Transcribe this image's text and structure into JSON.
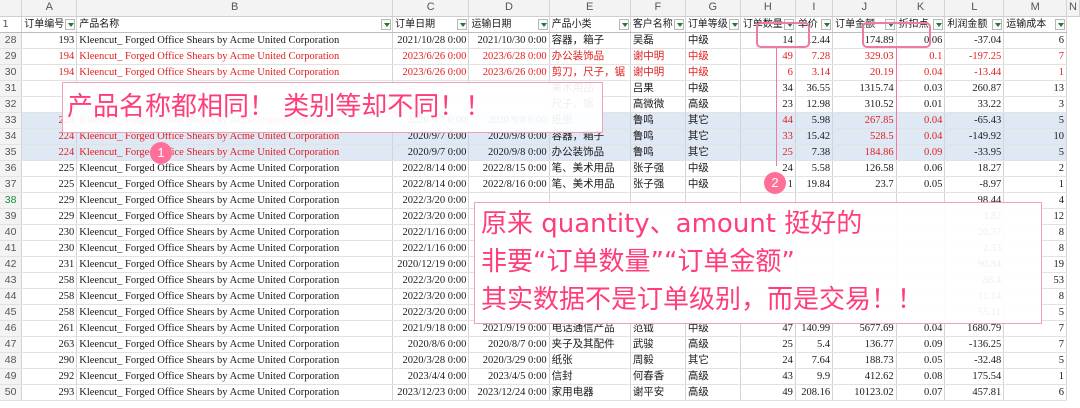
{
  "columns": [
    "A",
    "B",
    "C",
    "D",
    "E",
    "F",
    "G",
    "H",
    "I",
    "J",
    "K",
    "L",
    "M",
    "N"
  ],
  "header_row_number": "1",
  "fields": [
    "订单编号",
    "产品名称",
    "订单日期",
    "运输日期",
    "产品小类",
    "客户名称",
    "订单等级",
    "订单数量",
    "单价",
    "订单金额",
    "折扣点",
    "利润金额",
    "运输成本"
  ],
  "rows": [
    {
      "num": "28",
      "cells": [
        "193",
        "Kleencut_ Forged Office Shears by Acme United Corporation",
        "2021/10/28 0:00",
        "2021/10/30 0:00",
        "容器，箱子",
        "吴磊",
        "中级",
        "14",
        "12.44",
        "174.89",
        "0.06",
        "-37.04",
        "6"
      ],
      "style": ""
    },
    {
      "num": "29",
      "cells": [
        "194",
        "Kleencut_ Forged Office Shears by Acme United Corporation",
        "2023/6/26 0:00",
        "2023/6/28 0:00",
        "办公装饰品",
        "谢中明",
        "中级",
        "49",
        "7.28",
        "329.03",
        "0.1",
        "-197.25",
        "7"
      ],
      "style": "red"
    },
    {
      "num": "30",
      "cells": [
        "194",
        "Kleencut_ Forged Office Shears by Acme United Corporation",
        "2023/6/26 0:00",
        "2023/6/26 0:00",
        "剪刀，尺子，锯",
        "谢中明",
        "中级",
        "6",
        "3.14",
        "20.19",
        "0.04",
        "-13.44",
        "1"
      ],
      "style": "red"
    },
    {
      "num": "31",
      "cells": [
        "",
        "",
        "",
        "",
        "美术用品",
        "吕果",
        "中级",
        "34",
        "36.55",
        "1315.74",
        "0.03",
        "260.87",
        "13"
      ],
      "style": ""
    },
    {
      "num": "32",
      "cells": [
        "",
        "",
        "",
        "",
        "尺子，锯",
        "高微微",
        "高级",
        "23",
        "12.98",
        "310.52",
        "0.01",
        "33.22",
        "3"
      ],
      "style": ""
    },
    {
      "num": "33",
      "cells": [
        "224",
        "Kleencut_ Forged Office Shears by Acme United Corporation",
        "2020/9/7 0:00",
        "2020/9/8 0:00",
        "纸张",
        "鲁鸣",
        "其它",
        "44",
        "5.98",
        "267.85",
        "0.04",
        "-65.43",
        "5"
      ],
      "style": "blue"
    },
    {
      "num": "34",
      "cells": [
        "224",
        "Kleencut_ Forged Office Shears by Acme United Corporation",
        "2020/9/7 0:00",
        "2020/9/8 0:00",
        "容器，箱子",
        "鲁鸣",
        "其它",
        "33",
        "15.42",
        "528.5",
        "0.04",
        "-149.92",
        "10"
      ],
      "style": "blue"
    },
    {
      "num": "35",
      "cells": [
        "224",
        "Kleencut_ Forged Office Shears by Acme United Corporation",
        "2020/9/7 0:00",
        "2020/9/8 0:00",
        "办公装饰品",
        "鲁鸣",
        "其它",
        "25",
        "7.38",
        "184.86",
        "0.09",
        "-33.95",
        "5"
      ],
      "style": "blue"
    },
    {
      "num": "36",
      "cells": [
        "225",
        "Kleencut_ Forged Office Shears by Acme United Corporation",
        "2022/8/14 0:00",
        "2022/8/15 0:00",
        "笔、美术用品",
        "张子强",
        "中级",
        "24",
        "5.58",
        "126.58",
        "0.06",
        "18.27",
        "2"
      ],
      "style": ""
    },
    {
      "num": "37",
      "cells": [
        "225",
        "Kleencut_ Forged Office Shears by Acme United Corporation",
        "2022/8/14 0:00",
        "2022/8/16 0:00",
        "笔、美术用品",
        "张子强",
        "中级",
        "1",
        "19.84",
        "23.7",
        "0.05",
        "-8.97",
        "1"
      ],
      "style": ""
    },
    {
      "num": "38",
      "cells": [
        "229",
        "Kleencut_ Forged Office Shears by Acme United Corporation",
        "2022/3/20 0:00",
        "",
        "",
        "",
        "",
        "",
        "",
        "",
        "",
        "98.44",
        "4"
      ],
      "style": "sel"
    },
    {
      "num": "39",
      "cells": [
        "229",
        "Kleencut_ Forged Office Shears by Acme United Corporation",
        "2022/3/20 0:00",
        "",
        "",
        "",
        "",
        "",
        "",
        "",
        "",
        "3.82",
        "12"
      ],
      "style": ""
    },
    {
      "num": "40",
      "cells": [
        "230",
        "Kleencut_ Forged Office Shears by Acme United Corporation",
        "2022/1/16 0:00",
        "",
        "",
        "",
        "",
        "",
        "",
        "",
        "",
        "20.37",
        "8"
      ],
      "style": ""
    },
    {
      "num": "41",
      "cells": [
        "230",
        "Kleencut_ Forged Office Shears by Acme United Corporation",
        "2022/1/16 0:00",
        "",
        "",
        "",
        "",
        "",
        "",
        "",
        "",
        "2.33",
        "8"
      ],
      "style": ""
    },
    {
      "num": "42",
      "cells": [
        "231",
        "Kleencut_ Forged Office Shears by Acme United Corporation",
        "2020/12/19 0:00",
        "",
        "",
        "",
        "",
        "",
        "",
        "",
        "",
        "90.84",
        "19"
      ],
      "style": ""
    },
    {
      "num": "43",
      "cells": [
        "258",
        "Kleencut_ Forged Office Shears by Acme United Corporation",
        "2022/3/20 0:00",
        "",
        "",
        "",
        "",
        "",
        "",
        "",
        "",
        "88.4",
        "53"
      ],
      "style": ""
    },
    {
      "num": "44",
      "cells": [
        "258",
        "Kleencut_ Forged Office Shears by Acme United Corporation",
        "2022/3/20 0:00",
        "",
        "",
        "",
        "",
        "",
        "",
        "",
        "",
        "11.14",
        "8"
      ],
      "style": ""
    },
    {
      "num": "45",
      "cells": [
        "258",
        "Kleencut_ Forged Office Shears by Acme United Corporation",
        "2022/3/20 0:00",
        "",
        "",
        "",
        "",
        "",
        "",
        "",
        "",
        "55.11",
        "5"
      ],
      "style": ""
    },
    {
      "num": "46",
      "cells": [
        "261",
        "Kleencut_ Forged Office Shears by Acme United Corporation",
        "2021/9/18 0:00",
        "2021/9/19 0:00",
        "电话通信产品",
        "范钺",
        "中级",
        "47",
        "140.99",
        "5677.69",
        "0.04",
        "1680.79",
        "7"
      ],
      "style": ""
    },
    {
      "num": "47",
      "cells": [
        "263",
        "Kleencut_ Forged Office Shears by Acme United Corporation",
        "2020/8/6 0:00",
        "2020/8/7 0:00",
        "夹子及其配件",
        "武骏",
        "高级",
        "25",
        "5.4",
        "136.77",
        "0.09",
        "-136.25",
        "7"
      ],
      "style": ""
    },
    {
      "num": "48",
      "cells": [
        "290",
        "Kleencut_ Forged Office Shears by Acme United Corporation",
        "2020/3/28 0:00",
        "2020/3/29 0:00",
        "纸张",
        "周毅",
        "其它",
        "24",
        "7.64",
        "188.73",
        "0.05",
        "-32.48",
        "5"
      ],
      "style": ""
    },
    {
      "num": "49",
      "cells": [
        "292",
        "Kleencut_ Forged Office Shears by Acme United Corporation",
        "2023/4/4 0:00",
        "2023/4/5 0:00",
        "信封",
        "何春香",
        "高级",
        "43",
        "9.9",
        "412.62",
        "0.08",
        "175.54",
        "1"
      ],
      "style": ""
    },
    {
      "num": "50",
      "cells": [
        "293",
        "Kleencut_ Forged Office Shears by Acme United Corporation",
        "2023/12/23 0:00",
        "2023/12/24 0:00",
        "家用电器",
        "谢平安",
        "高级",
        "49",
        "208.16",
        "10123.02",
        "0.07",
        "457.81",
        "6"
      ],
      "style": ""
    }
  ],
  "callout1": {
    "badge": "1",
    "text": "产品名称都相同！ 类别等却不同！！"
  },
  "callout2": {
    "badge": "2",
    "line1": "原来 quantity、amount 挺好的",
    "line2": "非要“订单数量”“订单金额”",
    "line3": "其实数据不是订单级别，而是交易！！"
  },
  "colors": {
    "annotation": "#ff3d78",
    "highlight_row": "#dfe9f6",
    "red_text": "#e0201f"
  }
}
